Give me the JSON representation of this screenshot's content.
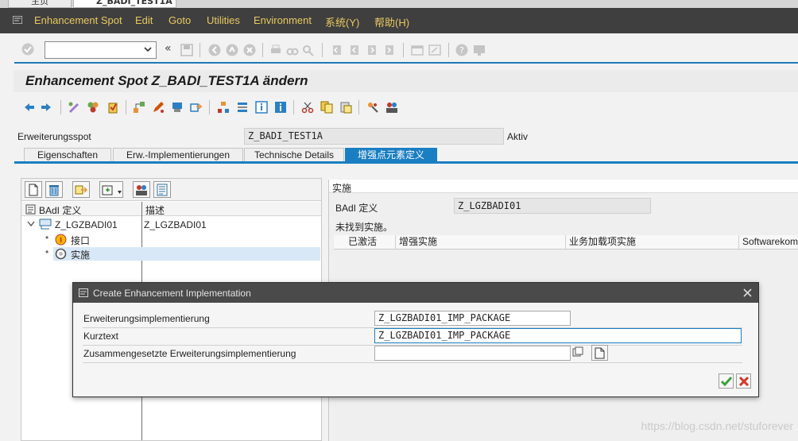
{
  "window_tabs": [
    "主页",
    "Z_BADI_TEST1A"
  ],
  "menu": [
    "Enhancement Spot",
    "Edit",
    "Goto",
    "Utilities",
    "Environment",
    "系统(Y)",
    "帮助(H)"
  ],
  "title": "Enhancement Spot Z_BADI_TEST1A ändern",
  "header": {
    "spot_label": "Erweiterungsspot",
    "spot_value": "Z_BADI_TEST1A",
    "status": "Aktiv"
  },
  "tabs": [
    "Eigenschaften",
    "Erw.-Implementierungen",
    "Technische Details",
    "增强点元素定义"
  ],
  "tree": {
    "col_badi": "BAdI 定义",
    "col_desc": "描述",
    "root_name": "Z_LGZBADI01",
    "root_desc": "Z_LGZBADI01",
    "child_interface": "接口",
    "child_impl": "实施"
  },
  "right": {
    "header": "实施",
    "badi_label": "BAdI 定义",
    "badi_value": "Z_LGZBADI01",
    "message": "未找到实施。",
    "columns": [
      "已激活",
      "增强实施",
      "业务加载项实施",
      "Softwarekom"
    ]
  },
  "dialog": {
    "title": "Create Enhancement Implementation",
    "impl_label": "Erweiterungsimplementierung",
    "impl_value": "Z_LGZBADI01_IMP_PACKAGE",
    "kurztext_label": "Kurztext",
    "kurztext_value": "Z_LGZBADI01_IMP_PACKAGE",
    "composite_label": "Zusammengesetzte Erweiterungsimplementierung",
    "composite_value": ""
  },
  "colors": {
    "menubar": "#3f3f3f",
    "menu_text": "#e9c95f",
    "accent": "#1a7ec2",
    "ok_green": "#3aa23a",
    "cancel_red": "#d23b2b"
  },
  "watermark": "https://blog.csdn.net/stuforever"
}
